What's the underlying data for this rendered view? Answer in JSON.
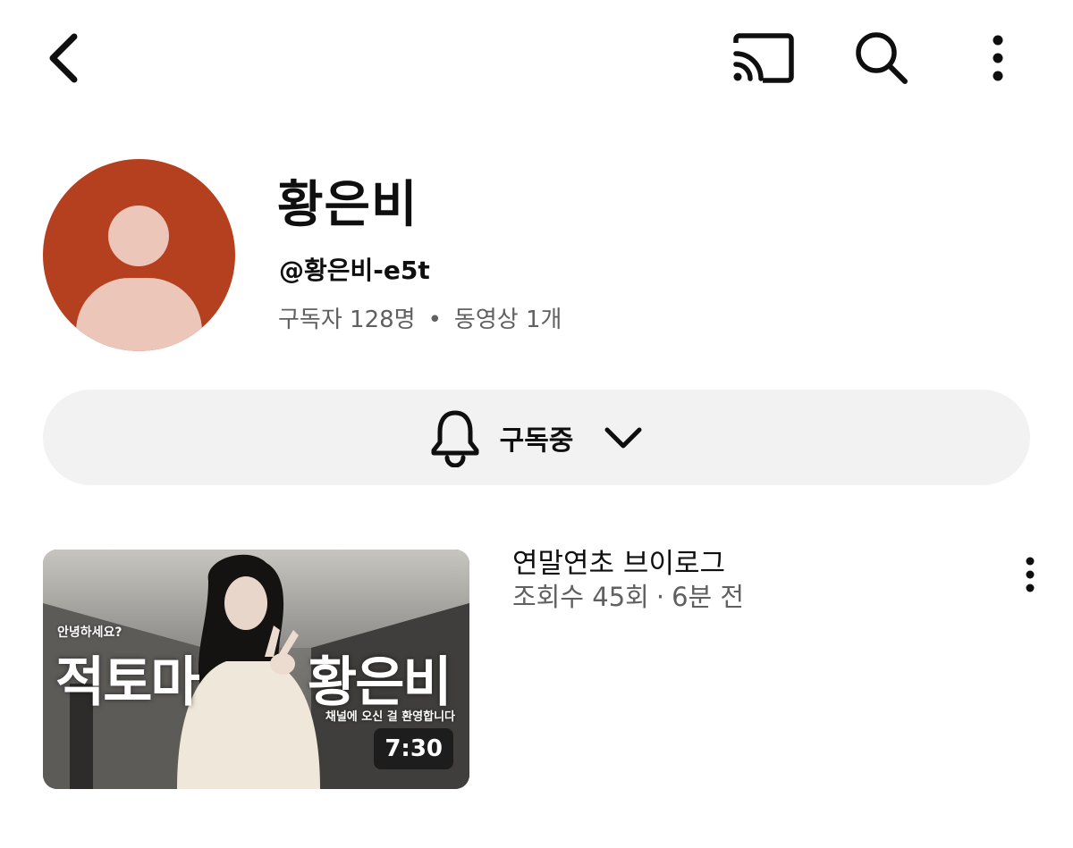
{
  "top_bar": {
    "back_icon": "chevron-left-icon",
    "cast_icon": "cast-icon",
    "search_icon": "search-icon",
    "more_icon": "more-vertical-icon"
  },
  "channel": {
    "name": "황은비",
    "handle": "@황은비-e5t",
    "subscribers": "구독자 128명",
    "separator": "•",
    "videos": "동영상 1개",
    "avatar_color": "#b5401f"
  },
  "subscribe_button": {
    "label": "구독중",
    "icon": "bell-icon",
    "dropdown_icon": "chevron-down-icon"
  },
  "videos": [
    {
      "title": "연말연초 브이로그",
      "views": "조회수 45회",
      "separator": "·",
      "age": "6분 전",
      "duration": "7:30",
      "thumbnail": {
        "greeting": "안녕하세요?",
        "left_text": "적토마",
        "right_text": "황은비",
        "welcome": "채널에 오신 걸 환영합니다"
      }
    }
  ]
}
